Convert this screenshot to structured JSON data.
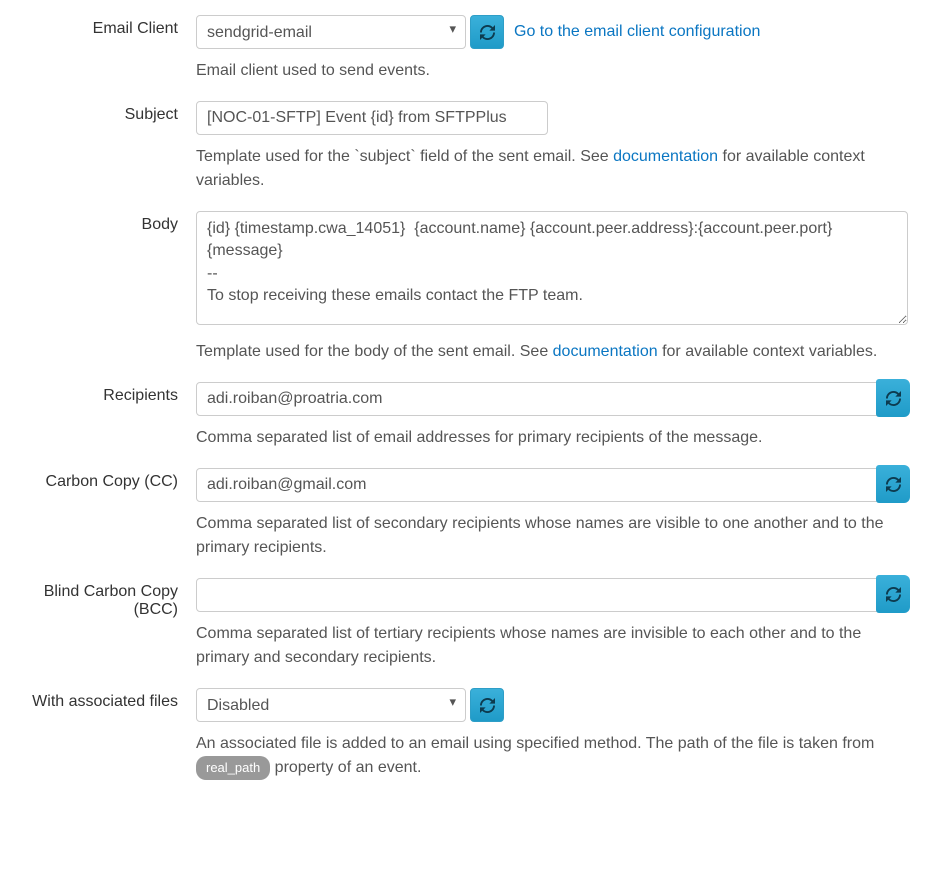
{
  "emailClient": {
    "label": "Email Client",
    "selected": "sendgrid-email",
    "link": "Go to the email client configuration",
    "help": "Email client used to send events."
  },
  "subject": {
    "label": "Subject",
    "value": "[NOC-01-SFTP] Event {id} from SFTPPlus",
    "help1": "Template used for the `subject` field of the sent email. See ",
    "helpLink": "documentation",
    "help2": " for available context variables."
  },
  "body": {
    "label": "Body",
    "value": "{id} {timestamp.cwa_14051}  {account.name} {account.peer.address}:{account.peer.port} {message}\n--\nTo stop receiving these emails contact the FTP team.",
    "help1": "Template used for the body of the sent email. See ",
    "helpLink": "documentation",
    "help2": " for available context variables."
  },
  "recipients": {
    "label": "Recipients",
    "value": "adi.roiban@proatria.com",
    "help": "Comma separated list of email addresses for primary recipients of the message."
  },
  "cc": {
    "label": "Carbon Copy (CC)",
    "value": "adi.roiban@gmail.com",
    "help": "Comma separated list of secondary recipients whose names are visible to one another and to the primary recipients."
  },
  "bcc": {
    "label": "Blind Carbon Copy (BCC)",
    "value": "",
    "help": "Comma separated list of tertiary recipients whose names are invisible to each other and to the primary and secondary recipients."
  },
  "assoc": {
    "label": "With associated files",
    "selected": "Disabled",
    "help1": "An associated file is added to an email using specified method. The path of the file is taken from ",
    "badge": "real_path",
    "help2": " property of an event."
  }
}
